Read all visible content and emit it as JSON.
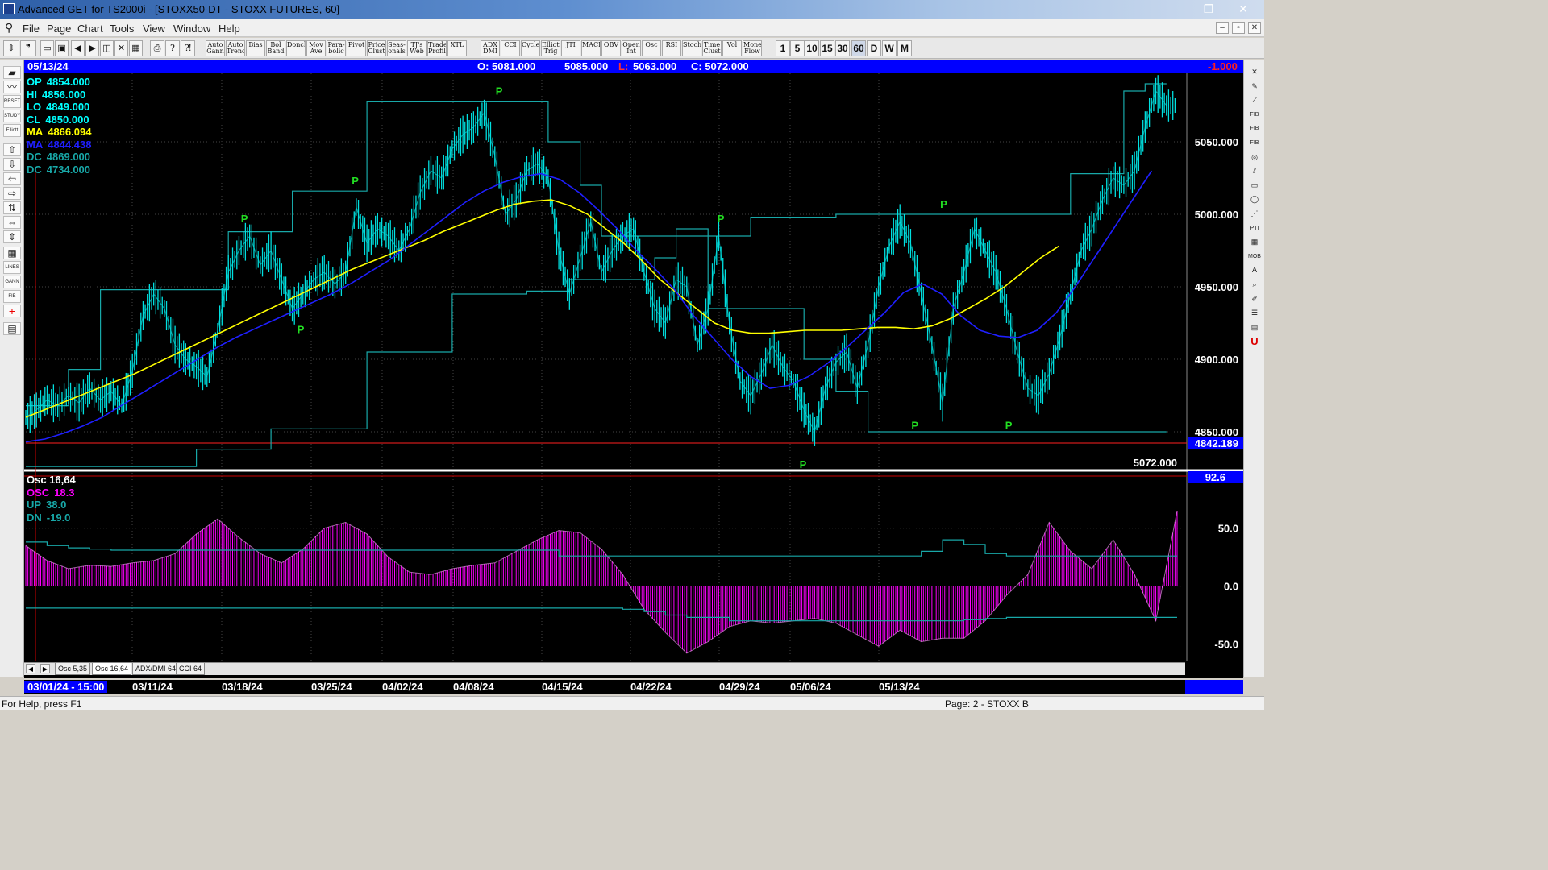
{
  "window": {
    "title": "Advanced GET for TS2000i - [STOXX50-DT - STOXX FUTURES, 60]",
    "min_glyph": "—",
    "max_glyph": "❐",
    "close_glyph": "✕"
  },
  "menu": [
    "File",
    "Page",
    "Chart",
    "Tools",
    "View",
    "Window",
    "Help"
  ],
  "mdi_controls": [
    "–",
    "▫",
    "✕"
  ],
  "toolbar": {
    "study_buttons": [
      "Auto Gann",
      "Auto Trend",
      "Bias",
      "Bol Band",
      "Donch",
      "Mov Ave",
      "Para-bolic",
      "Pivot",
      "Price Clust",
      "Seas-onals",
      "TJ's Web",
      "Trade Profile",
      "XTL",
      "ADX DMI",
      "CCI",
      "Cycles",
      "Elliott Trig",
      "JTI",
      "MACD",
      "OBV",
      "Open Int",
      "Osc",
      "RSI",
      "Stoch",
      "Time Clust",
      "Vol",
      "Money Flow"
    ],
    "intervals": [
      "1",
      "5",
      "10",
      "15",
      "30",
      "60",
      "D",
      "W",
      "M"
    ],
    "active_interval": "60"
  },
  "infobar": {
    "date": "05/13/24",
    "open": "O: 5081.000",
    "high": "5085.000",
    "low_label": "L:",
    "low": "5063.000",
    "close": "C: 5072.000",
    "change": "-1.000"
  },
  "legend_main": [
    {
      "label": "OP",
      "value": "4854.000",
      "color": "#00ffff"
    },
    {
      "label": "HI",
      "value": "4856.000",
      "color": "#00ffff"
    },
    {
      "label": "LO",
      "value": "4849.000",
      "color": "#00ffff"
    },
    {
      "label": "CL",
      "value": "4850.000",
      "color": "#00ffff"
    },
    {
      "label": "MA",
      "value": "4866.094",
      "color": "#ffff00"
    },
    {
      "label": "MA",
      "value": "4844.438",
      "color": "#1f1fff"
    },
    {
      "label": "DC",
      "value": "4869.000",
      "color": "#18a8a8"
    },
    {
      "label": "DC",
      "value": "4734.000",
      "color": "#18a8a8"
    }
  ],
  "legend_osc": [
    {
      "label": "Osc 16,64",
      "value": "",
      "color": "#ffffff"
    },
    {
      "label": "OSC",
      "value": "18.3",
      "color": "#ff00ff"
    },
    {
      "label": "UP",
      "value": "38.0",
      "color": "#18a8a8"
    },
    {
      "label": "DN",
      "value": "-19.0",
      "color": "#18a8a8"
    }
  ],
  "main_axis": {
    "ticks": [
      5050,
      5000,
      4950,
      4900,
      4850
    ],
    "tick_labels": [
      "5050.000",
      "5000.000",
      "4950.000",
      "4900.000",
      "4850.000"
    ],
    "cursor_value": 4842.189,
    "cursor_label": "4842.189",
    "last_label": "5072.000"
  },
  "osc_axis": {
    "ticks": [
      50,
      0,
      -50
    ],
    "tick_labels": [
      "50.0",
      "0.0",
      "-50.0"
    ],
    "top_label": "92.6"
  },
  "tabs": [
    "Osc 5,35",
    "Osc 16,64",
    "ADX/DMI 64",
    "CCI 64"
  ],
  "active_tab": "Osc 16,64",
  "dates": [
    "03/01/24 - 15:00",
    "03/11/24",
    "03/18/24",
    "03/25/24",
    "04/02/24",
    "04/08/24",
    "04/15/24",
    "04/22/24",
    "04/29/24",
    "05/06/24",
    "05/13/24"
  ],
  "status": {
    "help": "For Help, press F1",
    "page": "Page: 2 - STOXX B"
  },
  "chart_data": [
    {
      "type": "line",
      "title": "STOXX50-DT - STOXX FUTURES, 60",
      "ylim": [
        4825,
        5095
      ],
      "x": [
        0,
        10,
        20,
        30,
        40,
        50,
        60,
        70,
        80,
        90,
        100,
        110,
        120,
        130,
        140,
        150,
        160,
        170,
        180,
        190,
        200,
        210,
        220,
        230,
        240,
        250,
        260,
        270,
        280,
        290,
        300,
        310,
        320,
        330,
        340,
        350,
        360,
        370,
        380,
        390,
        400,
        410,
        420,
        430,
        440,
        450,
        460,
        470,
        480,
        490,
        500,
        510,
        520,
        530,
        540,
        550,
        560,
        570,
        580,
        590,
        600,
        610,
        620,
        630,
        640,
        650,
        660,
        670,
        680,
        690,
        700,
        710,
        720,
        730,
        740,
        750,
        760,
        770,
        780,
        790,
        800,
        810,
        820,
        830,
        840,
        850,
        860,
        870,
        880,
        890,
        900,
        910,
        920,
        930,
        940,
        950,
        960,
        970,
        980,
        990,
        1000,
        1010,
        1020,
        1030,
        1040,
        1050,
        1060,
        1070
      ],
      "series": [
        {
          "name": "CL",
          "values": [
            4860,
            4865,
            4872,
            4868,
            4875,
            4870,
            4880,
            4872,
            4878,
            4868,
            4892,
            4930,
            4945,
            4935,
            4910,
            4900,
            4895,
            4888,
            4920,
            4960,
            4975,
            4985,
            4965,
            4975,
            4955,
            4935,
            4945,
            4955,
            4960,
            4952,
            4960,
            5005,
            4980,
            4990,
            4985,
            4975,
            4990,
            5015,
            5030,
            5025,
            5045,
            5055,
            5060,
            5070,
            5040,
            5000,
            5010,
            5030,
            5035,
            5025,
            4975,
            4945,
            4970,
            4995,
            4960,
            4975,
            4985,
            4990,
            4960,
            4935,
            4925,
            4955,
            4950,
            4910,
            4935,
            4985,
            4925,
            4885,
            4875,
            4890,
            4910,
            4895,
            4885,
            4865,
            4850,
            4880,
            4898,
            4905,
            4880,
            4910,
            4950,
            4978,
            4995,
            4980,
            4945,
            4910,
            4870,
            4935,
            4960,
            4990,
            4975,
            4960,
            4935,
            4905,
            4880,
            4875,
            4890,
            4915,
            4945,
            4975,
            4990,
            5010,
            5025,
            5020,
            5030,
            5060,
            5085,
            5075
          ]
        },
        {
          "name": "MA",
          "values": [
            4860,
            4865,
            4870,
            4875,
            4880,
            4885,
            4890,
            4896,
            4902,
            4908,
            4914,
            4920,
            4926,
            4932,
            4938,
            4944,
            4950,
            4956,
            4962,
            4967,
            4972,
            4977,
            4982,
            4988,
            4993,
            4998,
            5003,
            5007,
            5009,
            5010,
            5006,
            5000,
            4990,
            4980,
            4968,
            4955,
            4945,
            4935,
            4925,
            4920,
            4918,
            4918,
            4919,
            4920,
            4920,
            4920,
            4921,
            4922,
            4922,
            4921,
            4923,
            4928,
            4935,
            4942,
            4950,
            4960,
            4970,
            4978
          ]
        },
        {
          "name": "MA",
          "values": [
            4843,
            4845,
            4849,
            4854,
            4860,
            4868,
            4876,
            4884,
            4892,
            4900,
            4908,
            4915,
            4921,
            4927,
            4933,
            4939,
            4945,
            4952,
            4960,
            4968,
            4978,
            4988,
            4998,
            5008,
            5016,
            5022,
            5026,
            5028,
            5024,
            5015,
            5003,
            4990,
            4975,
            4962,
            4948,
            4930,
            4915,
            4900,
            4888,
            4880,
            4882,
            4888,
            4897,
            4908,
            4920,
            4932,
            4946,
            4952,
            4945,
            4930,
            4920,
            4916,
            4915,
            4920,
            4932,
            4950,
            4970,
            4990,
            5010,
            5030
          ]
        },
        {
          "name": "DC",
          "values": [
            4868,
            4868,
            4868,
            4868,
            4893,
            4893,
            4893,
            4948,
            4948,
            4948,
            4948,
            4948,
            4948,
            4948,
            4948,
            4948,
            4948,
            4948,
            4948,
            4988,
            4988,
            4988,
            4988,
            4988,
            4988,
            5016,
            5016,
            5016,
            5016,
            5016,
            5016,
            5016,
            5078,
            5078,
            5078,
            5078,
            5078,
            5078,
            5078,
            5078,
            5078,
            5078,
            5078,
            5078,
            5078,
            5078,
            5078,
            5078,
            5078,
            5050,
            5050,
            5050,
            5020,
            5020,
            4985,
            4985,
            4985,
            4985,
            4985,
            4985,
            4985,
            4985,
            4985,
            4985,
            4985,
            4985,
            4985,
            4985,
            4998,
            4998,
            4998,
            4998,
            4998,
            4998,
            4998,
            4998,
            5000,
            5000,
            5000,
            5000,
            5000,
            5000,
            5000,
            5000,
            5000,
            5000,
            5000,
            5000,
            5000,
            5000,
            5000,
            5000,
            5000,
            5000,
            5000,
            5000,
            5000,
            5000,
            5028,
            5028,
            5028,
            5028,
            5028,
            5085,
            5085,
            5090,
            5090,
            5090
          ]
        },
        {
          "name": "DC",
          "values": [
            4826,
            4826,
            4826,
            4826,
            4826,
            4826,
            4826,
            4826,
            4826,
            4826,
            4826,
            4826,
            4826,
            4826,
            4826,
            4826,
            4838,
            4838,
            4838,
            4838,
            4838,
            4838,
            4838,
            4852,
            4852,
            4852,
            4852,
            4852,
            4852,
            4852,
            4852,
            4852,
            4905,
            4905,
            4905,
            4905,
            4905,
            4905,
            4905,
            4905,
            4945,
            4945,
            4945,
            4945,
            4945,
            4945,
            4945,
            4947,
            4947,
            4947,
            4947,
            4955,
            4955,
            4955,
            4955,
            4955,
            4955,
            4955,
            4955,
            4970,
            4970,
            4990,
            4990,
            4990,
            4935,
            4935,
            4935,
            4935,
            4935,
            4935,
            4935,
            4935,
            4935,
            4900,
            4900,
            4900,
            4878,
            4878,
            4878,
            4850,
            4850,
            4850,
            4850,
            4850,
            4850,
            4850,
            4850,
            4850,
            4850,
            4850,
            4850,
            4850,
            4850,
            4850,
            4850,
            4850,
            4850,
            4850,
            4850,
            4850,
            4850,
            4850,
            4850,
            4850,
            4850,
            4850,
            4850,
            4850
          ]
        }
      ],
      "pivots": [
        {
          "label": "P",
          "x": 205,
          "y": 4990,
          "kind": "high"
        },
        {
          "label": "P",
          "x": 258,
          "y": 4928,
          "kind": "low"
        },
        {
          "label": "P",
          "x": 309,
          "y": 5016,
          "kind": "high"
        },
        {
          "label": "P",
          "x": 444,
          "y": 5078,
          "kind": "high"
        },
        {
          "label": "P",
          "x": 652,
          "y": 4990,
          "kind": "high"
        },
        {
          "label": "P",
          "x": 729,
          "y": 4835,
          "kind": "low"
        },
        {
          "label": "P",
          "x": 834,
          "y": 4862,
          "kind": "low"
        },
        {
          "label": "P",
          "x": 861,
          "y": 5000,
          "kind": "high"
        },
        {
          "label": "P",
          "x": 922,
          "y": 4862,
          "kind": "low"
        }
      ]
    },
    {
      "type": "bar",
      "title": "Osc 16,64",
      "ylim": [
        -65,
        95
      ],
      "x": [
        0,
        20,
        40,
        60,
        80,
        100,
        120,
        140,
        160,
        180,
        200,
        220,
        240,
        260,
        280,
        300,
        320,
        340,
        360,
        380,
        400,
        420,
        440,
        460,
        480,
        500,
        520,
        540,
        560,
        580,
        600,
        620,
        640,
        660,
        680,
        700,
        720,
        740,
        760,
        780,
        800,
        820,
        840,
        860,
        880,
        900,
        920,
        940,
        960,
        980,
        1000,
        1020,
        1040,
        1060,
        1080
      ],
      "series": [
        {
          "name": "OSC",
          "values": [
            35,
            22,
            15,
            18,
            17,
            20,
            22,
            28,
            45,
            58,
            42,
            28,
            20,
            32,
            50,
            55,
            45,
            25,
            12,
            10,
            15,
            18,
            20,
            30,
            40,
            48,
            46,
            32,
            10,
            -20,
            -40,
            -58,
            -48,
            -35,
            -30,
            -32,
            -30,
            -28,
            -32,
            -42,
            -52,
            -38,
            -48,
            -45,
            -45,
            -30,
            -8,
            10,
            55,
            30,
            15,
            40,
            10,
            -30,
            65
          ]
        },
        {
          "name": "UP",
          "values": [
            38,
            35,
            33,
            32,
            31,
            31,
            31,
            31,
            31,
            31,
            31,
            31,
            31,
            31,
            31,
            31,
            31,
            31,
            31,
            31,
            31,
            31,
            31,
            31,
            31,
            26,
            26,
            26,
            26,
            26,
            26,
            26,
            26,
            26,
            26,
            26,
            26,
            26,
            26,
            26,
            26,
            26,
            30,
            40,
            36,
            28,
            26,
            26,
            26,
            26,
            26,
            26,
            26,
            26,
            26
          ]
        },
        {
          "name": "DN",
          "values": [
            -19,
            -19,
            -19,
            -19,
            -19,
            -19,
            -19,
            -19,
            -19,
            -19,
            -19,
            -19,
            -19,
            -19,
            -19,
            -19,
            -19,
            -19,
            -19,
            -19,
            -19,
            -19,
            -19,
            -19,
            -19,
            -19,
            -19,
            -19,
            -20,
            -22,
            -25,
            -27,
            -27,
            -30,
            -30,
            -30,
            -30,
            -30,
            -30,
            -30,
            -30,
            -30,
            -30,
            -30,
            -29,
            -28,
            -27,
            -27,
            -27,
            -27,
            -27,
            -27,
            -27,
            -27,
            -27
          ]
        }
      ]
    }
  ],
  "colors": {
    "price": "#00e0e0",
    "ma_fast": "#ffff00",
    "ma_slow": "#1f1fff",
    "donchian": "#18a8a8",
    "pivot": "#22dd22",
    "osc": "#ff00ff",
    "infobar": "#0000ff",
    "cursor_line": "#ff2020"
  }
}
